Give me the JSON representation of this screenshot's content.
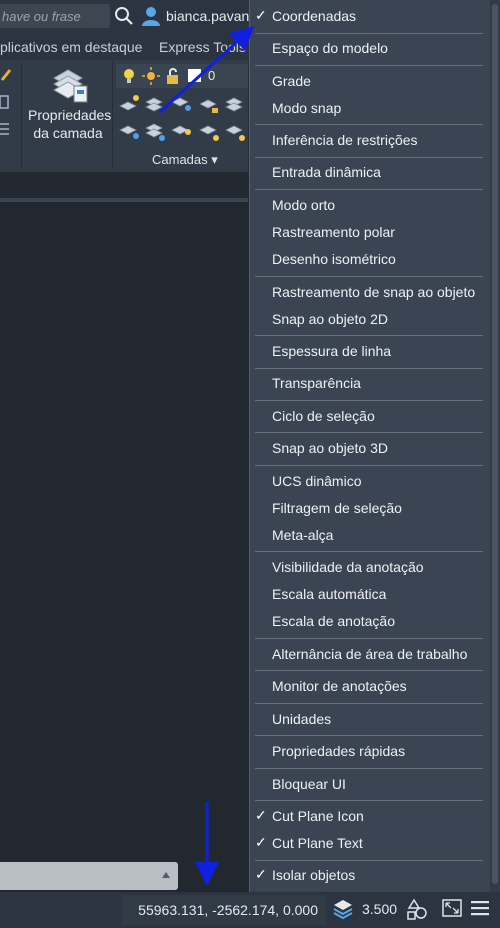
{
  "titlebar": {
    "search_placeholder": "have ou frase",
    "username": "bianca.pavane"
  },
  "ribbon": {
    "tabs": [
      "plicativos em destaque",
      "Express Tools"
    ],
    "properties_label_1": "Propriedades",
    "properties_label_2": "da camada",
    "layers_panel_label": "Camadas ▾",
    "current_layer": "0"
  },
  "statusbar": {
    "coordinates": "55963.131, -2562.174, 0.000",
    "annotation_scale": "3.500"
  },
  "menu": {
    "items": [
      {
        "label": "Coordenadas",
        "checked": true
      },
      {
        "label": "Espaço do modelo",
        "checked": false
      },
      {
        "label": "Grade",
        "checked": false
      },
      {
        "label": "Modo snap",
        "checked": false
      },
      {
        "label": "Inferência de restrições",
        "checked": false
      },
      {
        "label": "Entrada dinâmica",
        "checked": false
      },
      {
        "label": "Modo orto",
        "checked": false
      },
      {
        "label": "Rastreamento polar",
        "checked": false
      },
      {
        "label": "Desenho isométrico",
        "checked": false
      },
      {
        "label": "Rastreamento de snap ao objeto",
        "checked": false
      },
      {
        "label": "Snap ao objeto 2D",
        "checked": false
      },
      {
        "label": "Espessura de linha",
        "checked": false
      },
      {
        "label": "Transparência",
        "checked": false
      },
      {
        "label": "Ciclo de seleção",
        "checked": false
      },
      {
        "label": "Snap ao objeto 3D",
        "checked": false
      },
      {
        "label": "UCS dinâmico",
        "checked": false
      },
      {
        "label": "Filtragem de seleção",
        "checked": false
      },
      {
        "label": "Meta-alça",
        "checked": false
      },
      {
        "label": "Visibilidade da anotação",
        "checked": false
      },
      {
        "label": "Escala automática",
        "checked": false
      },
      {
        "label": "Escala de anotação",
        "checked": false
      },
      {
        "label": "Alternância de área de trabalho",
        "checked": false
      },
      {
        "label": "Monitor de anotações",
        "checked": false
      },
      {
        "label": "Unidades",
        "checked": false
      },
      {
        "label": "Propriedades rápidas",
        "checked": false
      },
      {
        "label": "Bloquear UI",
        "checked": false
      },
      {
        "label": "Cut Plane Icon",
        "checked": true
      },
      {
        "label": "Cut Plane Text",
        "checked": true
      },
      {
        "label": "Isolar objetos",
        "checked": true
      }
    ],
    "check_glyph": "✓"
  },
  "colors": {
    "annotation_arrow": "#1020e0",
    "menu_bg": "#3b4453"
  }
}
